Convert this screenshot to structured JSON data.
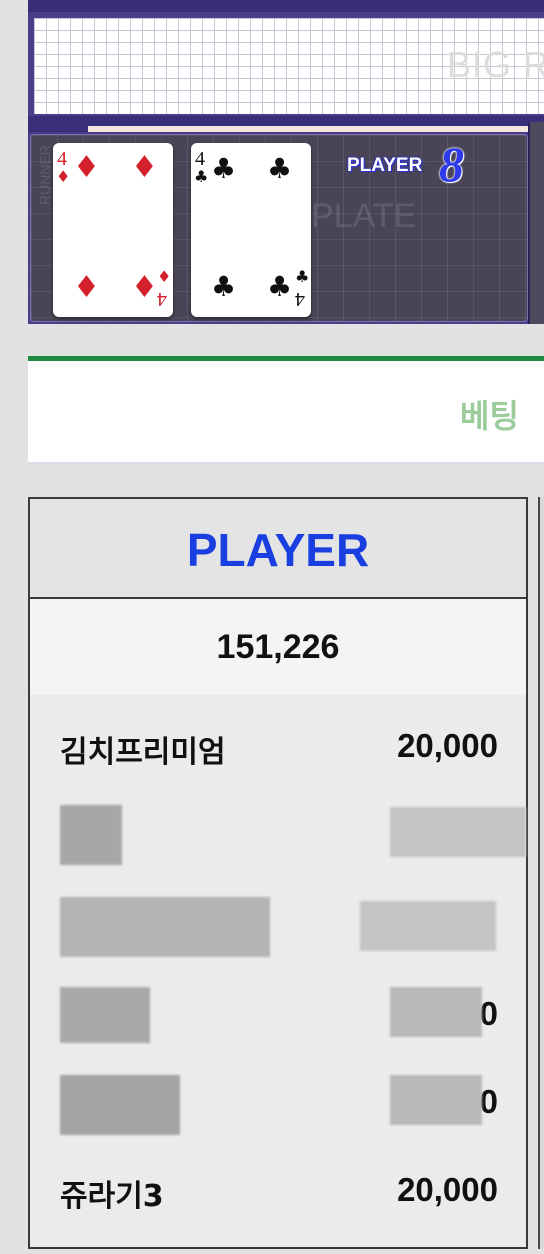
{
  "board": {
    "bigroad_label": "BIG R",
    "plate_text": "PLATE",
    "side_text": "RUNNER",
    "player_label": "PLAYER",
    "player_score": "8",
    "cards": [
      {
        "rank": "4",
        "suit": "♦",
        "color": "#d4202a"
      },
      {
        "rank": "4",
        "suit": "♣",
        "color": "#111111"
      }
    ]
  },
  "betting": {
    "title": "베팅"
  },
  "player_table": {
    "title": "PLAYER",
    "total": "151,226",
    "rows": [
      {
        "name": "김치프리미엄",
        "amount": "20,000"
      },
      {
        "name": "",
        "amount": ""
      },
      {
        "name": "",
        "amount": ""
      },
      {
        "name": "",
        "amount": "0"
      },
      {
        "name": "",
        "amount": "0"
      },
      {
        "name": "쥬라기3",
        "amount": "20,000"
      }
    ]
  }
}
